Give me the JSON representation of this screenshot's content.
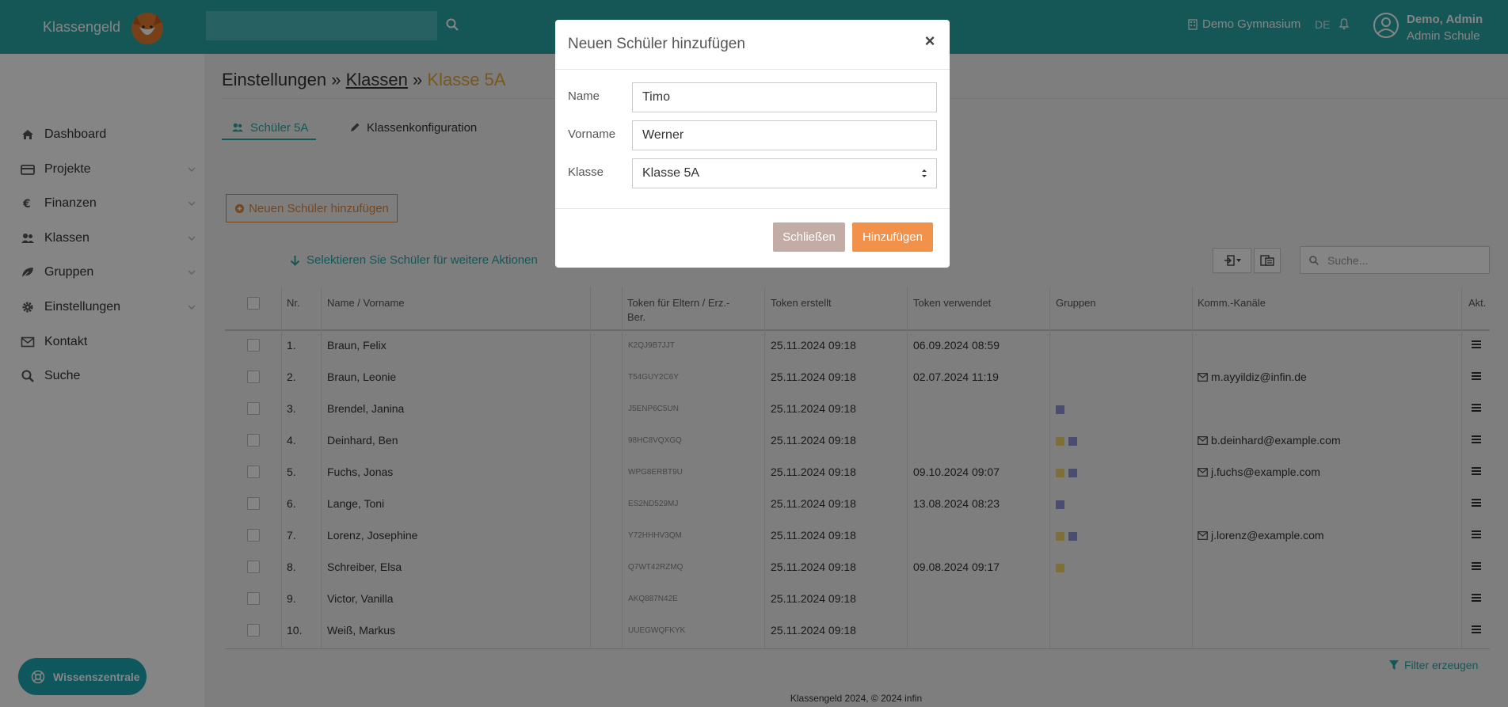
{
  "brand": {
    "name": "Klassengeld"
  },
  "topbar": {
    "school": "Demo Gymnasium",
    "language": "DE",
    "user_name": "Demo, Admin",
    "user_role": "Admin Schule"
  },
  "sidebar": {
    "items": [
      {
        "label": "Dashboard",
        "icon": "home-icon"
      },
      {
        "label": "Projekte",
        "icon": "credit-card-icon"
      },
      {
        "label": "Finanzen",
        "icon": "euro-icon"
      },
      {
        "label": "Klassen",
        "icon": "users-icon"
      },
      {
        "label": "Gruppen",
        "icon": "leaf-icon"
      },
      {
        "label": "Einstellungen",
        "icon": "gear-icon"
      },
      {
        "label": "Kontakt",
        "icon": "envelope-icon"
      },
      {
        "label": "Suche",
        "icon": "search-icon"
      }
    ],
    "help_label": "Wissenszentrale"
  },
  "breadcrumb": {
    "root": "Einstellungen",
    "sep": "»",
    "link": "Klassen",
    "current": "Klasse 5A"
  },
  "tabs": [
    {
      "label": "Schüler 5A"
    },
    {
      "label": "Klassenkonfiguration"
    }
  ],
  "actions": {
    "add_student": "Neuen Schüler hinzufügen",
    "select_hint": "Selektieren Sie Schüler für weitere Aktionen",
    "search_placeholder": "Suche...",
    "filter": "Filter erzeugen"
  },
  "table": {
    "headers": {
      "nr": "Nr.",
      "name": "Name / Vorname",
      "token": "Token für Eltern / Erz.-Ber.",
      "created": "Token erstellt",
      "used": "Token verwendet",
      "groups": "Gruppen",
      "channels": "Komm.-Kanäle",
      "actions": "Akt."
    },
    "rows": [
      {
        "nr": "1.",
        "name": "Braun, Felix",
        "token": "K2QJ9B7JJT",
        "created": "25.11.2024 09:18",
        "used": "06.09.2024 08:59",
        "groups": [],
        "email": ""
      },
      {
        "nr": "2.",
        "name": "Braun, Leonie",
        "token": "T54GUY2C6Y",
        "created": "25.11.2024 09:18",
        "used": "02.07.2024 11:19",
        "groups": [],
        "email": "m.ayyildiz@infin.de"
      },
      {
        "nr": "3.",
        "name": "Brendel, Janina",
        "token": "J5ENP6C5UN",
        "created": "25.11.2024 09:18",
        "used": "",
        "groups": [
          "#8e95d6"
        ],
        "email": ""
      },
      {
        "nr": "4.",
        "name": "Deinhard, Ben",
        "token": "98HC8VQXGQ",
        "created": "25.11.2024 09:18",
        "used": "",
        "groups": [
          "#f2d36b",
          "#8e95d6"
        ],
        "email": "b.deinhard@example.com"
      },
      {
        "nr": "5.",
        "name": "Fuchs, Jonas",
        "token": "WPG8ERBT9U",
        "created": "25.11.2024 09:18",
        "used": "09.10.2024 09:07",
        "groups": [
          "#f2d36b",
          "#8e95d6"
        ],
        "email": "j.fuchs@example.com"
      },
      {
        "nr": "6.",
        "name": "Lange, Toni",
        "token": "ES2ND529MJ",
        "created": "25.11.2024 09:18",
        "used": "13.08.2024 08:23",
        "groups": [
          "#8e95d6"
        ],
        "email": ""
      },
      {
        "nr": "7.",
        "name": "Lorenz, Josephine",
        "token": "Y72HHHV3QM",
        "created": "25.11.2024 09:18",
        "used": "",
        "groups": [
          "#f2d36b",
          "#8e95d6"
        ],
        "email": "j.lorenz@example.com"
      },
      {
        "nr": "8.",
        "name": "Schreiber, Elsa",
        "token": "Q7WT42RZMQ",
        "created": "25.11.2024 09:18",
        "used": "09.08.2024 09:17",
        "groups": [
          "#f2d36b"
        ],
        "email": ""
      },
      {
        "nr": "9.",
        "name": "Victor, Vanilla",
        "token": "AKQ887N42E",
        "created": "25.11.2024 09:18",
        "used": "",
        "groups": [],
        "email": ""
      },
      {
        "nr": "10.",
        "name": "Weiß, Markus",
        "token": "UUEGWQFKYK",
        "created": "25.11.2024 09:18",
        "used": "",
        "groups": [],
        "email": ""
      }
    ]
  },
  "footer": "Klassengeld 2024, © 2024 infin",
  "modal": {
    "title": "Neuen Schüler hinzufügen",
    "close_symbol": "×",
    "name_label": "Name",
    "name_value": "Timo",
    "firstname_label": "Vorname",
    "firstname_value": "Werner",
    "class_label": "Klasse",
    "class_value": "Klasse 5A",
    "close_button": "Schließen",
    "add_button": "Hinzufügen"
  },
  "colors": {
    "teal": "#2aa7a7",
    "orange": "#f2914a",
    "accent_gold": "#e6a73c"
  }
}
